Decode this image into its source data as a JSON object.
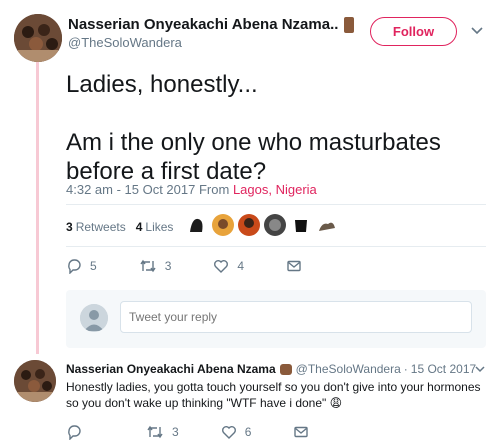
{
  "tweet": {
    "author_name": "Nasserian Onyeakachi Abena Nzama..",
    "handle": "@TheSoloWandera",
    "follow_label": "Follow",
    "text": "Ladies, honestly...\n\nAm i the only one who masturbates before a first date?",
    "time": "4:32 am - 15 Oct 2017",
    "from_label": "From",
    "location": "Lagos, Nigeria",
    "retweets_count": "3",
    "retweets_label": "Retweets",
    "likes_count": "4",
    "likes_label": "Likes",
    "actions": {
      "reply_count": "5",
      "retweet_count": "3",
      "like_count": "4"
    }
  },
  "reply_box": {
    "placeholder": "Tweet your reply"
  },
  "reply": {
    "author_name": "Nasserian Onyeakachi Abena Nzama",
    "handle": "@TheSoloWandera",
    "dot": "·",
    "date": "15 Oct 2017",
    "text": "Honestly ladies, you gotta touch yourself so you don't give into your hormones so you don't wake up thinking \"WTF have i done\"",
    "emoji": "😩",
    "actions": {
      "reply_count": "",
      "retweet_count": "3",
      "like_count": "6"
    }
  },
  "colors": {
    "accent": "#e0245e",
    "muted": "#657786",
    "thread_line": "#f7c9d4"
  }
}
